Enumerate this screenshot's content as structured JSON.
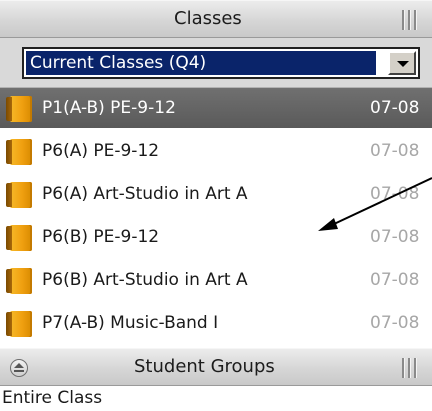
{
  "classes_panel": {
    "title": "Classes",
    "grip_icon": "resize-grip-icon"
  },
  "class_filter": {
    "selected": "Current Classes (Q4)",
    "arrow_icon": "chevron-down-icon"
  },
  "class_list": {
    "icon": "book-icon",
    "items": [
      {
        "name": "P1(A-B) PE-9-12",
        "date": "07-08",
        "selected": true
      },
      {
        "name": "P6(A) PE-9-12",
        "date": "07-08",
        "selected": false
      },
      {
        "name": "P6(A) Art-Studio in Art A",
        "date": "07-08",
        "selected": false
      },
      {
        "name": "P6(B) PE-9-12",
        "date": "07-08",
        "selected": false
      },
      {
        "name": "P6(B) Art-Studio in Art A",
        "date": "07-08",
        "selected": false
      },
      {
        "name": "P7(A-B) Music-Band I",
        "date": "07-08",
        "selected": false
      }
    ]
  },
  "student_groups_panel": {
    "title": "Student Groups",
    "collapse_icon": "collapse-up-icon",
    "grip_icon": "resize-grip-icon",
    "items": [
      {
        "label": "Entire Class"
      }
    ]
  },
  "colors": {
    "selected_row": "#666666",
    "selection_highlight": "#0a246a",
    "date_text": "#a7a7a7",
    "book_icon": "#f0a010"
  }
}
